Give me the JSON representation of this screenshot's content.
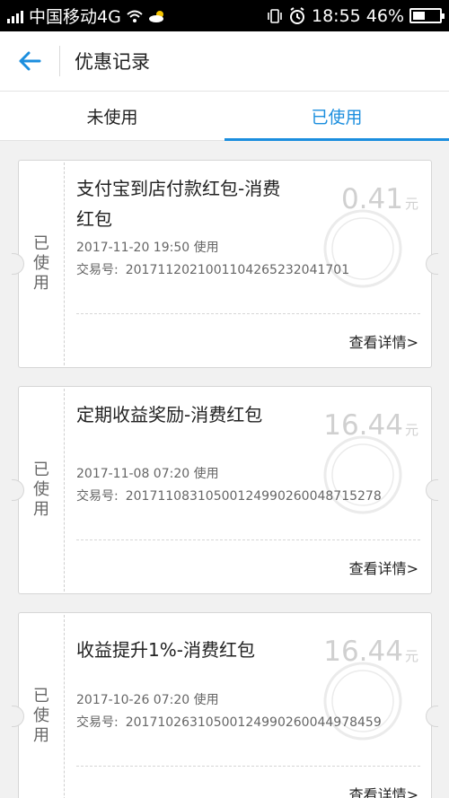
{
  "status_bar": {
    "carrier": "中国移动4G",
    "time": "18:55",
    "battery_text": "46%",
    "battery_level": 0.46,
    "icons": [
      "signal-icon",
      "wifi-icon",
      "weather-icon",
      "vibrate-icon",
      "alarm-icon",
      "battery-icon"
    ]
  },
  "header": {
    "back_icon": "arrow-left-icon",
    "title": "优惠记录",
    "accent_color": "#1b8ede"
  },
  "tabs": [
    {
      "label": "未使用",
      "active": false
    },
    {
      "label": "已使用",
      "active": true
    }
  ],
  "records": [
    {
      "stub_label": "已使用",
      "name": "支付宝到店付款红包-消费红包",
      "amount": "0.41",
      "unit": "元",
      "time": "2017-11-20 19:50 使用",
      "trade_label": "交易号:",
      "trade_no": "2017112021001104265232041701",
      "detail_link": "查看详情>"
    },
    {
      "stub_label": "已使用",
      "name": "定期收益奖励-消费红包",
      "amount": "16.44",
      "unit": "元",
      "time": "2017-11-08 07:20 使用",
      "trade_label": "交易号:",
      "trade_no": "20171108310500124990260048715278",
      "detail_link": "查看详情>"
    },
    {
      "stub_label": "已使用",
      "name": "收益提升1%-消费红包",
      "amount": "16.44",
      "unit": "元",
      "time": "2017-10-26 07:20 使用",
      "trade_label": "交易号:",
      "trade_no": "20171026310500124990260044978459",
      "detail_link": "查看详情>"
    }
  ],
  "stamp_text": "已使用"
}
